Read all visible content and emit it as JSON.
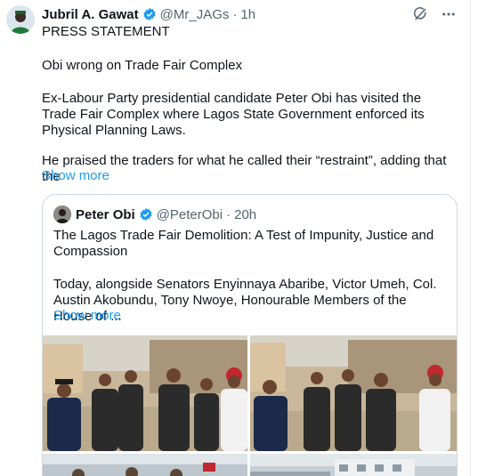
{
  "tweet": {
    "author_name": "Jubril A. Gawat",
    "handle": "@Mr_JAGs",
    "time": "1h",
    "paragraphs": [
      "PRESS STATEMENT",
      "Obi wrong on Trade Fair Complex",
      "Ex-Labour Party presidential candidate Peter Obi has visited the Trade Fair Complex where Lagos State Government enforced its Physical Planning Laws.",
      "He praised the traders for what he called their “restraint”, adding that the"
    ],
    "show_more": "Show more"
  },
  "quoted_tweet": {
    "author_name": "Peter Obi",
    "handle": "@PeterObi",
    "time": "20h",
    "paragraphs": [
      "The Lagos Trade Fair Demolition: A Test of Impunity, Justice and Compassion",
      "Today, alongside Senators Enyinnaya Abaribe, Victor Umeh, Col. Austin Akobundu, Tony Nwoye, Honourable Members of the House of ..."
    ],
    "show_more": "Show more"
  },
  "colors": {
    "accent": "#1d9bf0",
    "muted": "#536471",
    "text": "#0f1419",
    "border": "#cfd9de"
  },
  "icons": {
    "verified": "verified-badge-icon",
    "grok": "grok-icon",
    "more": "more-icon"
  }
}
